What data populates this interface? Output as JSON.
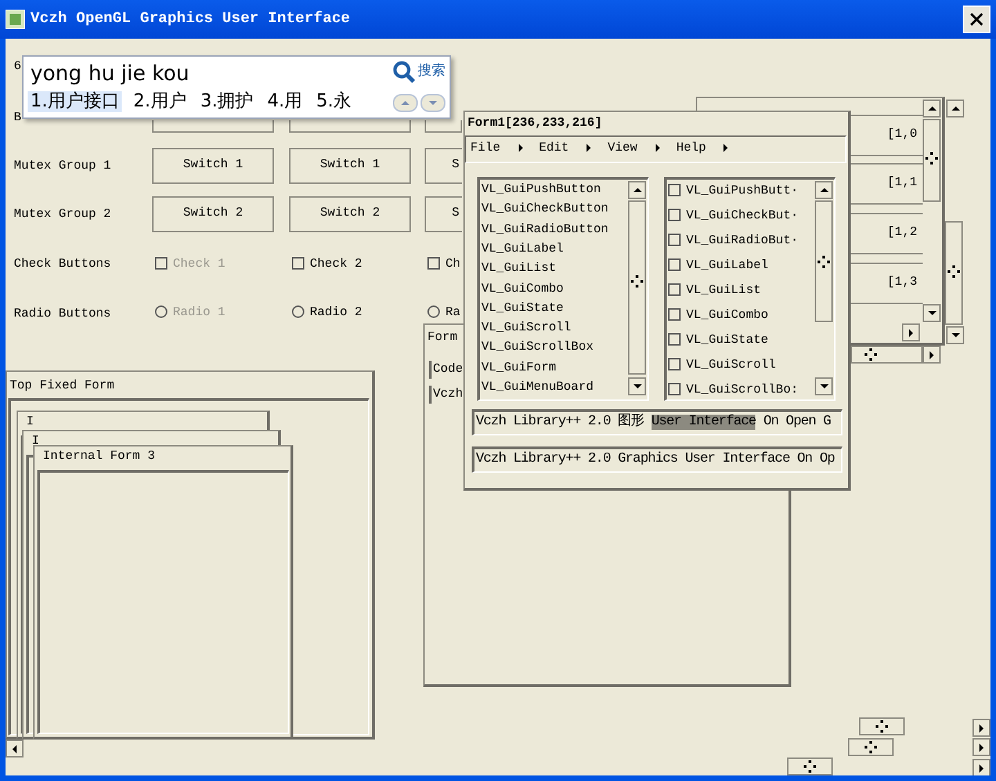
{
  "window": {
    "title": "Vczh OpenGL Graphics User Interface"
  },
  "ime": {
    "input": "yong hu jie kou",
    "search_label": "搜索",
    "candidates": [
      {
        "label": "1.用户接口",
        "selected": true
      },
      {
        "label": "2.用户",
        "selected": false
      },
      {
        "label": "3.拥护",
        "selected": false
      },
      {
        "label": "4.用",
        "selected": false
      },
      {
        "label": "5.永",
        "selected": false
      }
    ]
  },
  "panel": {
    "fragment": "6",
    "rows": [
      {
        "kind": "hidden-buttons",
        "label": "B"
      },
      {
        "kind": "push",
        "label": "Mutex Group 1",
        "items": [
          {
            "label": "Switch 1"
          },
          {
            "label": "Switch 1"
          },
          {
            "label": "S"
          }
        ]
      },
      {
        "kind": "push",
        "label": "Mutex Group 2",
        "items": [
          {
            "label": "Switch 2"
          },
          {
            "label": "Switch 2"
          },
          {
            "label": "S"
          }
        ]
      },
      {
        "kind": "check",
        "label": "Check Buttons",
        "items": [
          {
            "label": "Check 1",
            "disabled": true,
            "checked": false
          },
          {
            "label": "Check 2",
            "disabled": false,
            "checked": false
          },
          {
            "label": "Ch",
            "disabled": false,
            "checked": false
          }
        ]
      },
      {
        "kind": "radio",
        "label": "Radio Buttons",
        "items": [
          {
            "label": "Radio 1",
            "disabled": true,
            "selected": false
          },
          {
            "label": "Radio 2",
            "disabled": false,
            "selected": false
          },
          {
            "label": "Ra",
            "disabled": false,
            "selected": false
          }
        ]
      }
    ]
  },
  "back_form": {
    "title": "Form",
    "lines": [
      "Code",
      "Vczh"
    ]
  },
  "grid_window": {
    "cells": [
      "[1,0",
      "[1,1",
      "[1,2",
      "[1,3"
    ]
  },
  "top_fixed_form": {
    "title": "Top Fixed Form",
    "internal_forms": [
      {
        "title": "I"
      },
      {
        "title": "I"
      },
      {
        "title": "Internal Form 3"
      }
    ]
  },
  "form1": {
    "title": "Form1[236,233,216]",
    "menu": [
      {
        "label": "File"
      },
      {
        "label": "Edit"
      },
      {
        "label": "View"
      },
      {
        "label": "Help"
      }
    ],
    "list_items": [
      "VL_GuiPushButton",
      "VL_GuiCheckButton",
      "VL_GuiRadioButton",
      "VL_GuiLabel",
      "VL_GuiList",
      "VL_GuiCombo",
      "VL_GuiState",
      "VL_GuiScroll",
      "VL_GuiScrollBox",
      "VL_GuiForm",
      "VL_GuiMenuBoard"
    ],
    "check_items": [
      {
        "label": "VL_GuiPushButt·",
        "checked": false
      },
      {
        "label": "VL_GuiCheckBut·",
        "checked": false
      },
      {
        "label": "VL_GuiRadioBut·",
        "checked": false
      },
      {
        "label": "VL_GuiLabel",
        "checked": false
      },
      {
        "label": "VL_GuiList",
        "checked": false
      },
      {
        "label": "VL_GuiCombo",
        "checked": false
      },
      {
        "label": "VL_GuiState",
        "checked": false
      },
      {
        "label": "VL_GuiScroll",
        "checked": false
      },
      {
        "label": "VL_GuiScrollBo:",
        "checked": false
      }
    ],
    "field1": {
      "before": "Vczh Library++ 2.0 图形 ",
      "selected_text": "User Interface",
      "after": " On Open G"
    },
    "field2": {
      "value": "Vczh Library++ 2.0 Graphics User Interface On Op"
    }
  }
}
